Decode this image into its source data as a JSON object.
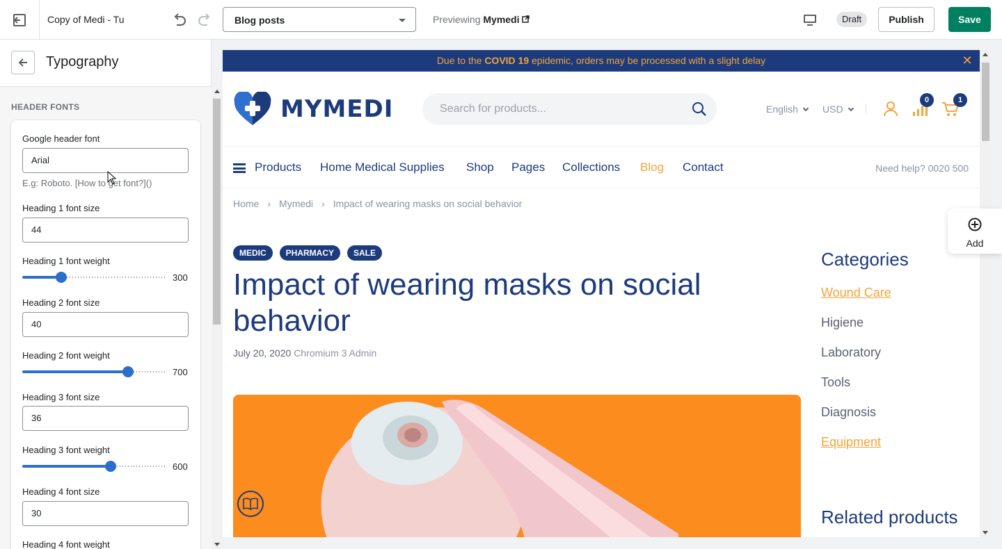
{
  "topbar": {
    "theme_name": "Copy of Medi - Tu",
    "page_select": "Blog posts",
    "previewing_label": "Previewing",
    "previewing_store": "Mymedi",
    "draft": "Draft",
    "publish": "Publish",
    "save": "Save"
  },
  "sidebar": {
    "title": "Typography",
    "section": "HEADER FONTS",
    "google_font_label": "Google header font",
    "google_font_value": "Arial",
    "google_font_help": "E.g: Roboto. [How to get font?]()",
    "h1_size_label": "Heading 1 font size",
    "h1_size_value": "44",
    "h1_weight_label": "Heading 1 font weight",
    "h1_weight_value": "300",
    "h1_weight_level": 0.27,
    "h2_size_label": "Heading 2 font size",
    "h2_size_value": "40",
    "h2_weight_label": "Heading 2 font weight",
    "h2_weight_value": "700",
    "h2_weight_level": 0.73,
    "h3_size_label": "Heading 3 font size",
    "h3_size_value": "36",
    "h3_weight_label": "Heading 3 font weight",
    "h3_weight_value": "600",
    "h3_weight_level": 0.61,
    "h4_size_label": "Heading 4 font size",
    "h4_size_value": "30",
    "h4_weight_label": "Heading 4 font weight"
  },
  "preview": {
    "announcement_pre": "Due to the ",
    "announcement_bold": "COVID 19",
    "announcement_post": " epidemic, orders may be processed with a slight delay",
    "logo_text": "MYMEDI",
    "search_placeholder": "Search for products...",
    "language": "English",
    "currency": "USD",
    "compare_count": "0",
    "cart_count": "1",
    "nav": [
      "Products",
      "Home Medical Supplies",
      "Shop",
      "Pages",
      "Collections",
      "Blog",
      "Contact"
    ],
    "help": "Need help? 0020 500",
    "breadcrumbs": [
      "Home",
      "Mymedi",
      "Impact of wearing masks on social behavior"
    ],
    "tags": [
      "MEDIC",
      "PHARMACY",
      "SALE"
    ],
    "post_title": "Impact of wearing masks on social behavior",
    "post_date": "July 20, 2020",
    "post_author": "Chromium 3 Admin",
    "categories_title": "Categories",
    "categories": [
      "Wound Care",
      "Higiene",
      "Laboratory",
      "Tools",
      "Diagnosis",
      "Equipment"
    ],
    "related_title": "Related products"
  },
  "add_button": "Add",
  "colors": {
    "brand_navy": "#1c3b7c",
    "accent_orange": "#f5a33a",
    "save_green": "#008060",
    "slider_blue": "#2c6ecb"
  }
}
